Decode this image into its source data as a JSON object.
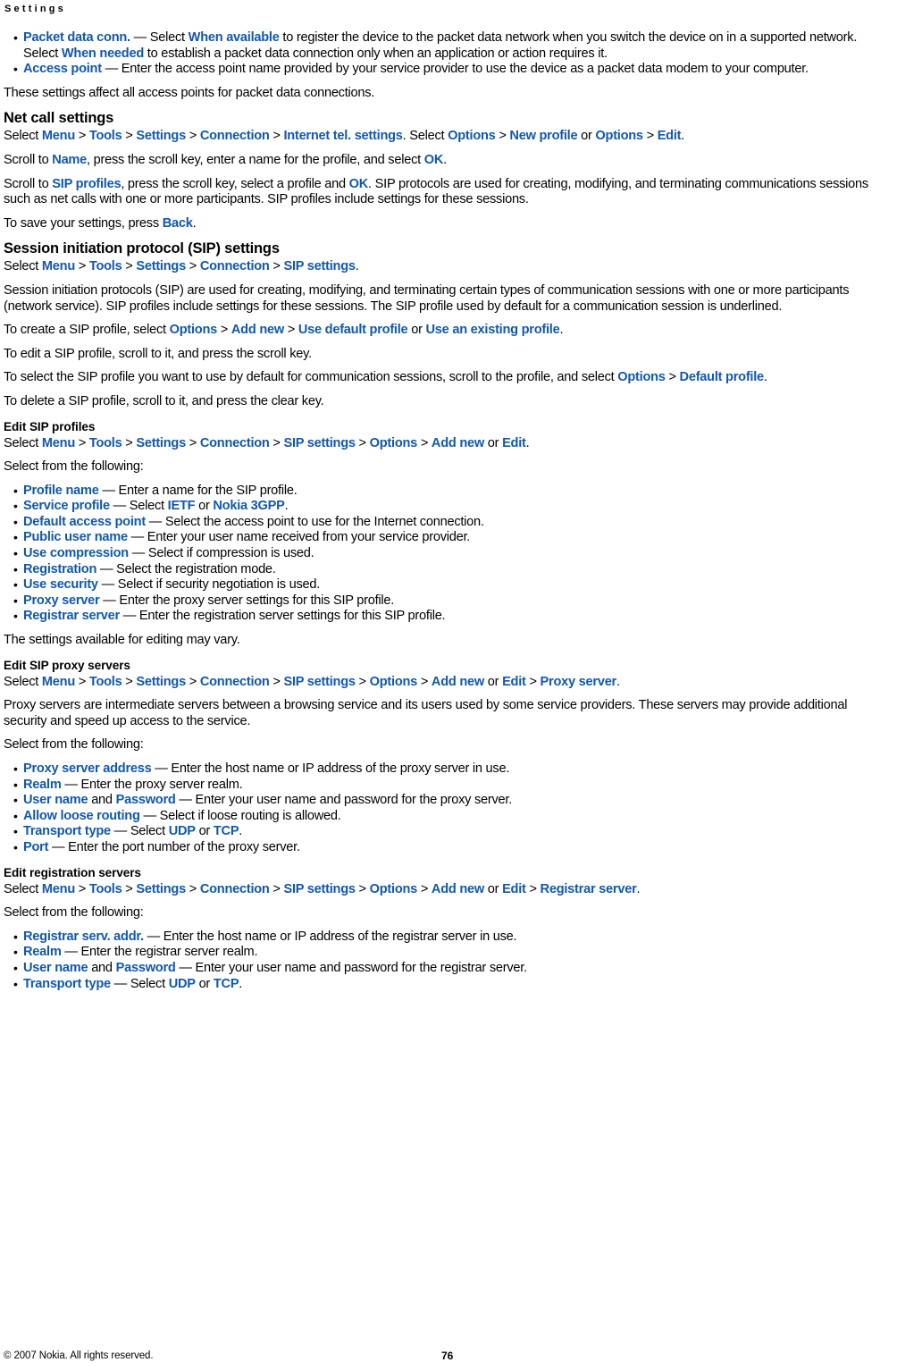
{
  "header": {
    "running_head": "Settings"
  },
  "colors": {
    "link": "#1158ad",
    "text": "#000000",
    "background": "#ffffff"
  },
  "blocks": [
    {
      "type": "bullet-list",
      "items": [
        [
          {
            "t": "link",
            "v": "Packet data conn."
          },
          {
            "t": "text",
            "v": " — Select "
          },
          {
            "t": "link",
            "v": "When available"
          },
          {
            "t": "text",
            "v": " to register the device to the packet data network when you switch the device on in a supported network. Select "
          },
          {
            "t": "link",
            "v": "When needed"
          },
          {
            "t": "text",
            "v": " to establish a packet data connection only when an application or action requires it."
          }
        ],
        [
          {
            "t": "link",
            "v": "Access point"
          },
          {
            "t": "text",
            "v": " — Enter the access point name provided by your service provider to use the device as a packet data modem to your computer."
          }
        ]
      ]
    },
    {
      "type": "paragraph",
      "runs": [
        {
          "t": "text",
          "v": "These settings affect all access points for packet data connections."
        }
      ]
    },
    {
      "type": "heading2",
      "text": "Net call settings"
    },
    {
      "type": "paragraph",
      "runs": [
        {
          "t": "text",
          "v": "Select "
        },
        {
          "t": "link",
          "v": "Menu"
        },
        {
          "t": "sep",
          "v": " > "
        },
        {
          "t": "link",
          "v": "Tools"
        },
        {
          "t": "sep",
          "v": " > "
        },
        {
          "t": "link",
          "v": "Settings"
        },
        {
          "t": "sep",
          "v": " > "
        },
        {
          "t": "link",
          "v": "Connection"
        },
        {
          "t": "sep",
          "v": " > "
        },
        {
          "t": "link",
          "v": "Internet tel. settings"
        },
        {
          "t": "text",
          "v": ". Select "
        },
        {
          "t": "link",
          "v": "Options"
        },
        {
          "t": "sep",
          "v": " > "
        },
        {
          "t": "link",
          "v": "New profile"
        },
        {
          "t": "text",
          "v": " or "
        },
        {
          "t": "link",
          "v": "Options"
        },
        {
          "t": "sep",
          "v": " > "
        },
        {
          "t": "link",
          "v": "Edit"
        },
        {
          "t": "text",
          "v": "."
        }
      ]
    },
    {
      "type": "paragraph",
      "runs": [
        {
          "t": "text",
          "v": "Scroll to "
        },
        {
          "t": "link",
          "v": "Name"
        },
        {
          "t": "text",
          "v": ", press the scroll key, enter a name for the profile, and select "
        },
        {
          "t": "link",
          "v": "OK"
        },
        {
          "t": "text",
          "v": "."
        }
      ]
    },
    {
      "type": "paragraph",
      "runs": [
        {
          "t": "text",
          "v": "Scroll to "
        },
        {
          "t": "link",
          "v": "SIP profiles"
        },
        {
          "t": "text",
          "v": ", press the scroll key, select a profile and "
        },
        {
          "t": "link",
          "v": "OK"
        },
        {
          "t": "text",
          "v": ". SIP protocols are used for creating, modifying, and terminating communications sessions such as net calls with one or more participants. SIP profiles include settings for these sessions."
        }
      ]
    },
    {
      "type": "paragraph",
      "runs": [
        {
          "t": "text",
          "v": "To save your settings, press "
        },
        {
          "t": "link",
          "v": "Back"
        },
        {
          "t": "text",
          "v": "."
        }
      ]
    },
    {
      "type": "heading2",
      "text": "Session initiation protocol (SIP) settings"
    },
    {
      "type": "paragraph",
      "runs": [
        {
          "t": "text",
          "v": "Select "
        },
        {
          "t": "link",
          "v": "Menu"
        },
        {
          "t": "sep",
          "v": " > "
        },
        {
          "t": "link",
          "v": "Tools"
        },
        {
          "t": "sep",
          "v": " > "
        },
        {
          "t": "link",
          "v": "Settings"
        },
        {
          "t": "sep",
          "v": " > "
        },
        {
          "t": "link",
          "v": "Connection"
        },
        {
          "t": "sep",
          "v": " > "
        },
        {
          "t": "link",
          "v": "SIP settings"
        },
        {
          "t": "text",
          "v": "."
        }
      ]
    },
    {
      "type": "paragraph",
      "runs": [
        {
          "t": "text",
          "v": "Session initiation protocols (SIP) are used for creating, modifying, and terminating certain types of communication sessions with one or more participants (network service). SIP profiles include settings for these sessions. The SIP profile used by default for a communication session is underlined."
        }
      ]
    },
    {
      "type": "paragraph",
      "runs": [
        {
          "t": "text",
          "v": "To create a SIP profile, select "
        },
        {
          "t": "link",
          "v": "Options"
        },
        {
          "t": "sep",
          "v": " > "
        },
        {
          "t": "link",
          "v": "Add new"
        },
        {
          "t": "sep",
          "v": " > "
        },
        {
          "t": "link",
          "v": "Use default profile"
        },
        {
          "t": "text",
          "v": " or "
        },
        {
          "t": "link",
          "v": "Use an existing profile"
        },
        {
          "t": "text",
          "v": "."
        }
      ]
    },
    {
      "type": "paragraph",
      "runs": [
        {
          "t": "text",
          "v": "To edit a SIP profile, scroll to it, and press the scroll key."
        }
      ]
    },
    {
      "type": "paragraph",
      "runs": [
        {
          "t": "text",
          "v": "To select the SIP profile you want to use by default for communication sessions, scroll to the profile, and select "
        },
        {
          "t": "link",
          "v": "Options"
        },
        {
          "t": "sep",
          "v": " > "
        },
        {
          "t": "link",
          "v": "Default profile"
        },
        {
          "t": "text",
          "v": "."
        }
      ]
    },
    {
      "type": "paragraph",
      "runs": [
        {
          "t": "text",
          "v": "To delete a SIP profile, scroll to it, and press the clear key."
        }
      ]
    },
    {
      "type": "heading3",
      "text": "Edit SIP profiles"
    },
    {
      "type": "paragraph",
      "runs": [
        {
          "t": "text",
          "v": "Select "
        },
        {
          "t": "link",
          "v": "Menu"
        },
        {
          "t": "sep",
          "v": " > "
        },
        {
          "t": "link",
          "v": "Tools"
        },
        {
          "t": "sep",
          "v": " > "
        },
        {
          "t": "link",
          "v": "Settings"
        },
        {
          "t": "sep",
          "v": " > "
        },
        {
          "t": "link",
          "v": "Connection"
        },
        {
          "t": "sep",
          "v": " > "
        },
        {
          "t": "link",
          "v": "SIP settings"
        },
        {
          "t": "sep",
          "v": " > "
        },
        {
          "t": "link",
          "v": "Options"
        },
        {
          "t": "sep",
          "v": " > "
        },
        {
          "t": "link",
          "v": "Add new"
        },
        {
          "t": "text",
          "v": " or "
        },
        {
          "t": "link",
          "v": "Edit"
        },
        {
          "t": "text",
          "v": "."
        }
      ]
    },
    {
      "type": "paragraph",
      "runs": [
        {
          "t": "text",
          "v": "Select from the following:"
        }
      ]
    },
    {
      "type": "bullet-list",
      "items": [
        [
          {
            "t": "link",
            "v": "Profile name"
          },
          {
            "t": "text",
            "v": " — Enter a name for the SIP profile."
          }
        ],
        [
          {
            "t": "link",
            "v": "Service profile"
          },
          {
            "t": "text",
            "v": " — Select "
          },
          {
            "t": "link",
            "v": "IETF"
          },
          {
            "t": "text",
            "v": " or "
          },
          {
            "t": "link",
            "v": "Nokia 3GPP"
          },
          {
            "t": "text",
            "v": "."
          }
        ],
        [
          {
            "t": "link",
            "v": "Default access point"
          },
          {
            "t": "text",
            "v": " — Select the access point to use for the Internet connection."
          }
        ],
        [
          {
            "t": "link",
            "v": "Public user name"
          },
          {
            "t": "text",
            "v": " — Enter your user name received from your service provider."
          }
        ],
        [
          {
            "t": "link",
            "v": "Use compression"
          },
          {
            "t": "text",
            "v": " — Select if compression is used."
          }
        ],
        [
          {
            "t": "link",
            "v": "Registration"
          },
          {
            "t": "text",
            "v": " — Select the registration mode."
          }
        ],
        [
          {
            "t": "link",
            "v": "Use security"
          },
          {
            "t": "text",
            "v": " — Select if security negotiation is used."
          }
        ],
        [
          {
            "t": "link",
            "v": "Proxy server"
          },
          {
            "t": "text",
            "v": " — Enter the proxy server settings for this SIP profile."
          }
        ],
        [
          {
            "t": "link",
            "v": "Registrar server"
          },
          {
            "t": "text",
            "v": " — Enter the registration server settings for this SIP profile."
          }
        ]
      ]
    },
    {
      "type": "paragraph",
      "runs": [
        {
          "t": "text",
          "v": "The settings available for editing may vary."
        }
      ]
    },
    {
      "type": "heading3",
      "text": "Edit SIP proxy servers"
    },
    {
      "type": "paragraph",
      "runs": [
        {
          "t": "text",
          "v": "Select "
        },
        {
          "t": "link",
          "v": "Menu"
        },
        {
          "t": "sep",
          "v": " > "
        },
        {
          "t": "link",
          "v": "Tools"
        },
        {
          "t": "sep",
          "v": " > "
        },
        {
          "t": "link",
          "v": "Settings"
        },
        {
          "t": "sep",
          "v": " > "
        },
        {
          "t": "link",
          "v": "Connection"
        },
        {
          "t": "sep",
          "v": " > "
        },
        {
          "t": "link",
          "v": "SIP settings"
        },
        {
          "t": "sep",
          "v": " > "
        },
        {
          "t": "link",
          "v": "Options"
        },
        {
          "t": "sep",
          "v": " > "
        },
        {
          "t": "link",
          "v": "Add new"
        },
        {
          "t": "text",
          "v": " or "
        },
        {
          "t": "link",
          "v": "Edit"
        },
        {
          "t": "sep",
          "v": " > "
        },
        {
          "t": "link",
          "v": "Proxy server"
        },
        {
          "t": "text",
          "v": "."
        }
      ]
    },
    {
      "type": "paragraph",
      "runs": [
        {
          "t": "text",
          "v": "Proxy servers are intermediate servers between a browsing service and its users used by some service providers. These servers may provide additional security and speed up access to the service."
        }
      ]
    },
    {
      "type": "paragraph",
      "runs": [
        {
          "t": "text",
          "v": "Select from the following:"
        }
      ]
    },
    {
      "type": "bullet-list",
      "items": [
        [
          {
            "t": "link",
            "v": "Proxy server address"
          },
          {
            "t": "text",
            "v": " — Enter the host name or IP address of the proxy server in use."
          }
        ],
        [
          {
            "t": "link",
            "v": "Realm"
          },
          {
            "t": "text",
            "v": " — Enter the proxy server realm."
          }
        ],
        [
          {
            "t": "link",
            "v": "User name"
          },
          {
            "t": "text",
            "v": " and "
          },
          {
            "t": "link",
            "v": "Password"
          },
          {
            "t": "text",
            "v": " — Enter your user name and password for the proxy server."
          }
        ],
        [
          {
            "t": "link",
            "v": "Allow loose routing"
          },
          {
            "t": "text",
            "v": " — Select if loose routing is allowed."
          }
        ],
        [
          {
            "t": "link",
            "v": "Transport type"
          },
          {
            "t": "text",
            "v": " — Select "
          },
          {
            "t": "link",
            "v": "UDP"
          },
          {
            "t": "text",
            "v": " or "
          },
          {
            "t": "link",
            "v": "TCP"
          },
          {
            "t": "text",
            "v": "."
          }
        ],
        [
          {
            "t": "link",
            "v": "Port"
          },
          {
            "t": "text",
            "v": " — Enter the port number of the proxy server."
          }
        ]
      ]
    },
    {
      "type": "heading3",
      "text": "Edit registration servers"
    },
    {
      "type": "paragraph",
      "runs": [
        {
          "t": "text",
          "v": "Select "
        },
        {
          "t": "link",
          "v": "Menu"
        },
        {
          "t": "sep",
          "v": " > "
        },
        {
          "t": "link",
          "v": "Tools"
        },
        {
          "t": "sep",
          "v": " > "
        },
        {
          "t": "link",
          "v": "Settings"
        },
        {
          "t": "sep",
          "v": " > "
        },
        {
          "t": "link",
          "v": "Connection"
        },
        {
          "t": "sep",
          "v": " > "
        },
        {
          "t": "link",
          "v": "SIP settings"
        },
        {
          "t": "sep",
          "v": " > "
        },
        {
          "t": "link",
          "v": "Options"
        },
        {
          "t": "sep",
          "v": " > "
        },
        {
          "t": "link",
          "v": "Add new"
        },
        {
          "t": "text",
          "v": " or "
        },
        {
          "t": "link",
          "v": "Edit"
        },
        {
          "t": "sep",
          "v": " > "
        },
        {
          "t": "link",
          "v": "Registrar server"
        },
        {
          "t": "text",
          "v": "."
        }
      ]
    },
    {
      "type": "paragraph",
      "runs": [
        {
          "t": "text",
          "v": "Select from the following:"
        }
      ]
    },
    {
      "type": "bullet-list",
      "items": [
        [
          {
            "t": "link",
            "v": "Registrar serv. addr."
          },
          {
            "t": "text",
            "v": " — Enter the host name or IP address of the registrar server in use."
          }
        ],
        [
          {
            "t": "link",
            "v": "Realm"
          },
          {
            "t": "text",
            "v": " — Enter the registrar server realm."
          }
        ],
        [
          {
            "t": "link",
            "v": "User name"
          },
          {
            "t": "text",
            "v": " and "
          },
          {
            "t": "link",
            "v": "Password"
          },
          {
            "t": "text",
            "v": " — Enter your user name and password for the registrar server."
          }
        ],
        [
          {
            "t": "link",
            "v": "Transport type"
          },
          {
            "t": "text",
            "v": " — Select "
          },
          {
            "t": "link",
            "v": "UDP"
          },
          {
            "t": "text",
            "v": " or "
          },
          {
            "t": "link",
            "v": "TCP"
          },
          {
            "t": "text",
            "v": "."
          }
        ]
      ]
    }
  ],
  "footer": {
    "copyright": "© 2007 Nokia. All rights reserved.",
    "page_number": "76"
  },
  "bullet_glyph": "•"
}
